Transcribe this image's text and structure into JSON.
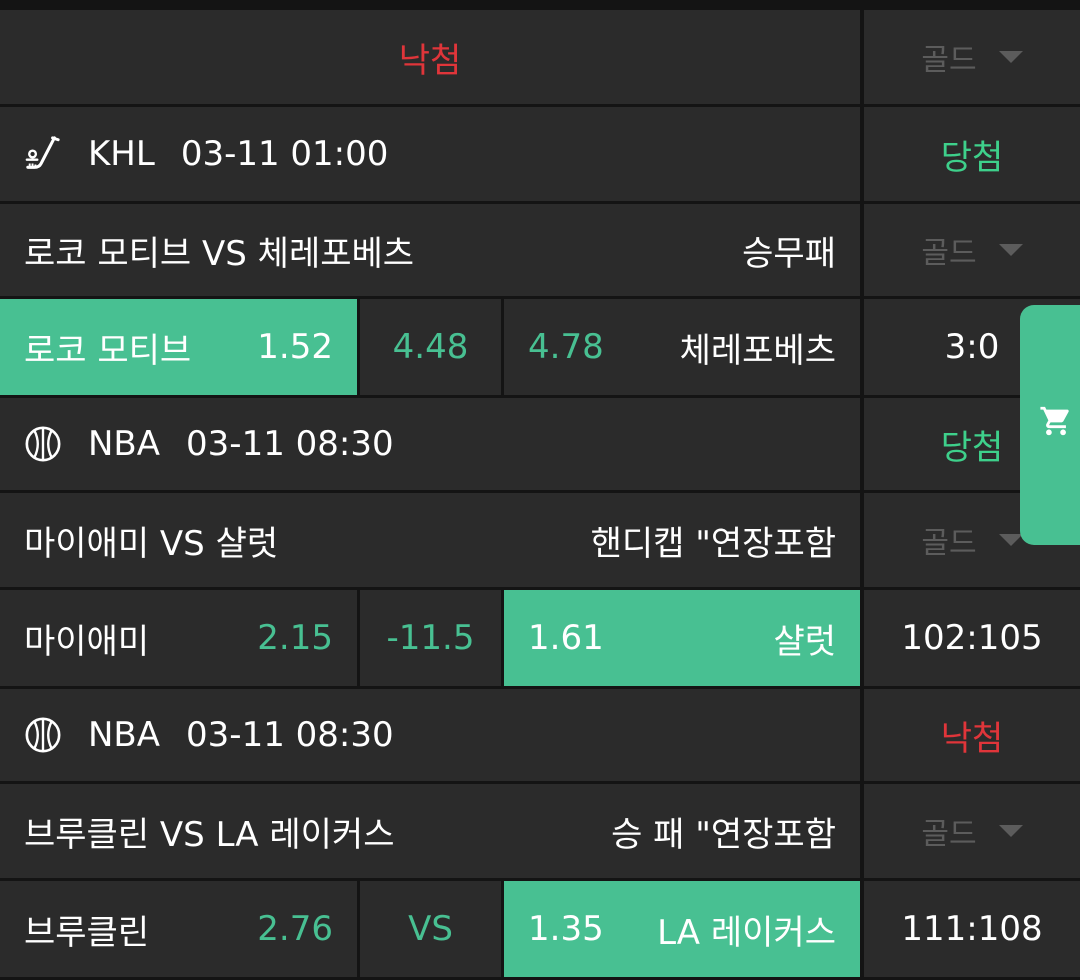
{
  "top_row": {
    "status": "낙첨",
    "gold_label": "골드"
  },
  "games": [
    {
      "sport_icon": "hockey-stick-icon",
      "league": "KHL",
      "datetime": "03-11 01:00",
      "result": "당첨",
      "result_color": "#3ed08b",
      "match_title": "로코 모티브 VS 체레포베츠",
      "bet_type": "승무패",
      "gold_label": "골드",
      "home": "로코 모티브",
      "home_odds": "1.52",
      "middle": "4.48",
      "away_odds": "4.78",
      "away": "체레포베츠",
      "score": "3:0",
      "selected": "home"
    },
    {
      "sport_icon": "basketball-icon",
      "league": "NBA",
      "datetime": "03-11 08:30",
      "result": "당첨",
      "result_color": "#3ed08b",
      "match_title": "마이애미 VS 샬럿",
      "bet_type": "핸디캡 \"연장포함",
      "gold_label": "골드",
      "home": "마이애미",
      "home_odds": "2.15",
      "middle": "-11.5",
      "away_odds": "1.61",
      "away": "샬럿",
      "score": "102:105",
      "selected": "away"
    },
    {
      "sport_icon": "basketball-icon",
      "league": "NBA",
      "datetime": "03-11 08:30",
      "result": "낙첨",
      "result_color": "#e0353a",
      "match_title": "브루클린 VS LA 레이커스",
      "bet_type": "승 패 \"연장포함",
      "gold_label": "골드",
      "home": "브루클린",
      "home_odds": "2.76",
      "middle": "VS",
      "away_odds": "1.35",
      "away": "LA 레이커스",
      "score": "111:108",
      "selected": "away"
    }
  ],
  "cart": {
    "icon": "cart-icon",
    "color": "#48c092"
  }
}
